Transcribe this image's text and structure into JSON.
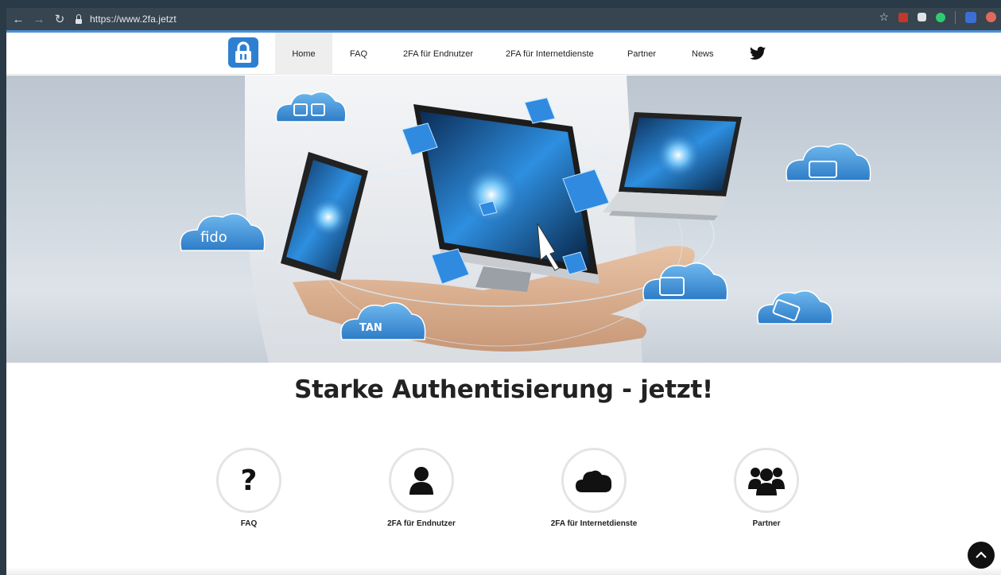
{
  "browser": {
    "url": "https://www.2fa.jetzt"
  },
  "nav": {
    "items": [
      {
        "label": "Home"
      },
      {
        "label": "FAQ"
      },
      {
        "label": "2FA für Endnutzer"
      },
      {
        "label": "2FA für Internetdienste"
      },
      {
        "label": "Partner"
      },
      {
        "label": "News"
      }
    ]
  },
  "hero": {
    "cloud_labels": [
      "fido",
      "TAN"
    ]
  },
  "main": {
    "heading": "Starke Authentisierung - jetzt!",
    "features": [
      {
        "label": "FAQ",
        "icon": "question-icon"
      },
      {
        "label": "2FA für Endnutzer",
        "icon": "user-icon"
      },
      {
        "label": "2FA für Internetdienste",
        "icon": "cloud-icon"
      },
      {
        "label": "Partner",
        "icon": "users-icon"
      }
    ]
  },
  "colors": {
    "brand": "#2e7fd1",
    "toolbar": "#36454f",
    "accent": "#4a90d9"
  }
}
